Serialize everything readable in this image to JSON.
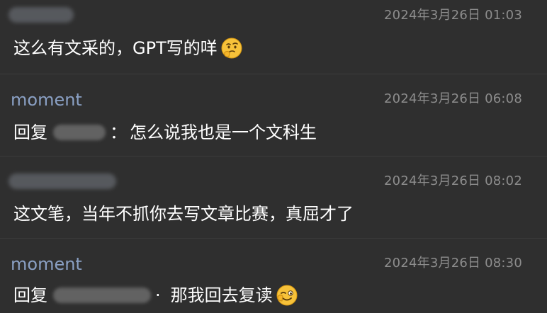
{
  "messages": [
    {
      "author": "",
      "time": "2024年3月26日 01:03",
      "text": "这么有文采的，GPT写的咩",
      "emoji": "thinking-face-icon"
    },
    {
      "author": "moment",
      "time": "2024年3月26日 06:08",
      "reply_prefix": "回复",
      "colon": "：",
      "text": "怎么说我也是一个文科生"
    },
    {
      "author": "",
      "time": "2024年3月26日 08:02",
      "text": "这文笔，当年不抓你去写文章比赛，真屈才了"
    },
    {
      "author": "moment",
      "time": "2024年3月26日 08:30",
      "reply_prefix": "回复",
      "colon": "·",
      "text": "那我回去复读",
      "emoji": "winking-face-icon"
    }
  ],
  "colors": {
    "background": "#2f2f2f",
    "author": "#8aa0c4",
    "timestamp": "#8d8d8d",
    "text": "#ffffff",
    "divider": "#3b3b3b"
  }
}
